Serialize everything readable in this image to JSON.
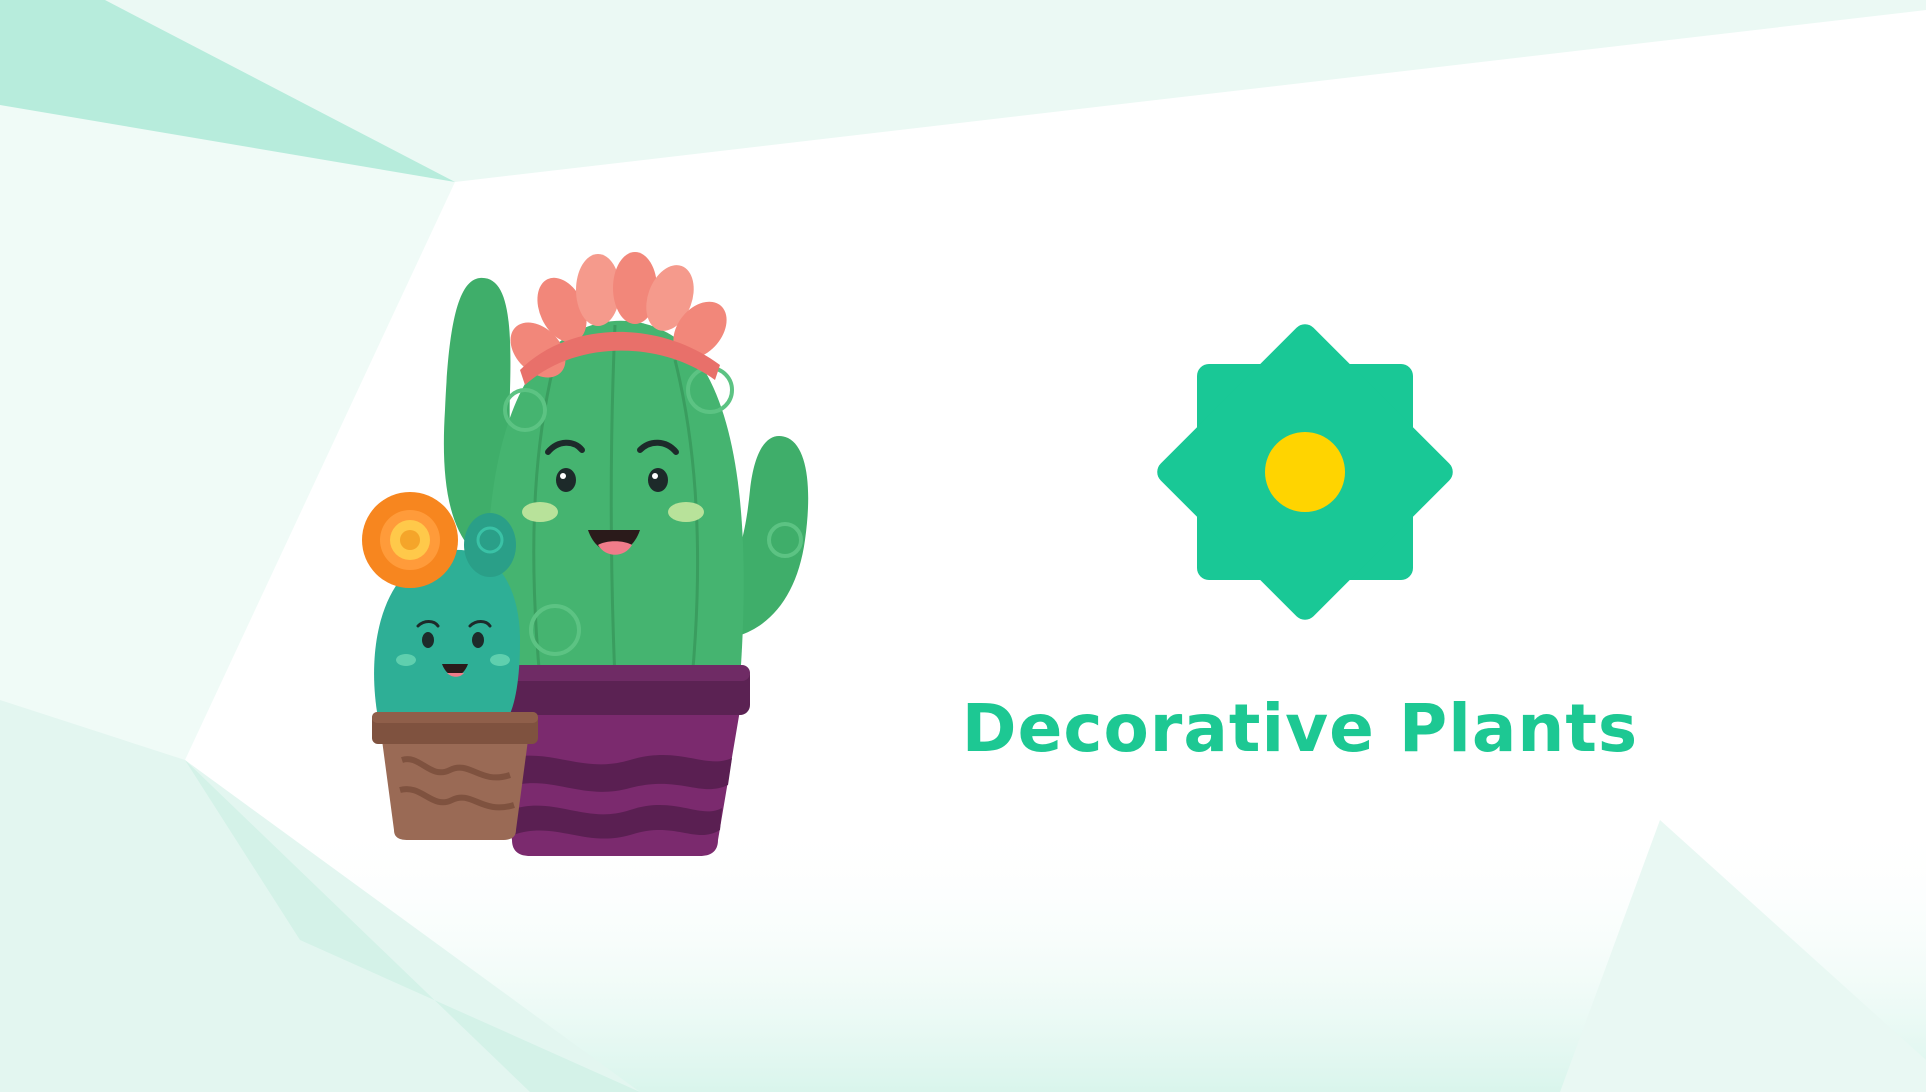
{
  "brand": {
    "title": "Decorative Plants",
    "title_color": "#1dc893"
  },
  "logo": {
    "icon": "flower-badge-icon",
    "badge_color": "#19c896",
    "center_color": "#ffd400"
  },
  "illustration": {
    "name": "cactus-pair-illustration",
    "large_cactus_color": "#3fae6a",
    "small_cactus_color": "#2eaf96",
    "large_pot_color": "#7b2a6e",
    "small_pot_color": "#9a6a55",
    "large_flower_color": "#f2877a",
    "small_flower_color": "#f7861f"
  },
  "background": {
    "accent_color": "#bfeee0",
    "light_color": "#e8f8f3"
  }
}
